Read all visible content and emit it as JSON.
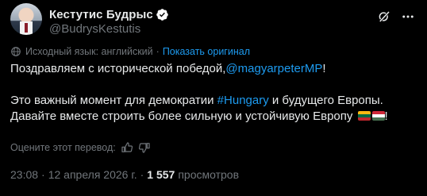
{
  "author": {
    "name": "Кестутис Будрыс",
    "handle": "@BudrysKestutis",
    "verified": true
  },
  "translation": {
    "source_label": "Исходный язык: английский",
    "separator": "·",
    "show_original_label": "Показать оригинал"
  },
  "tweet": {
    "line1_prefix": "Поздравляем с исторической победой,",
    "mention": "@magyarpeterMP",
    "line1_suffix": "!",
    "line2_prefix": "Это важный момент для демократии ",
    "hashtag": "#Hungary",
    "line2_suffix": " и будущего Европы.",
    "line3_text": "Давайте вместе строить более сильную и устойчивую Европу ",
    "line3_suffix": "!",
    "flags": [
      "lithuania-flag",
      "hungary-flag"
    ]
  },
  "rating": {
    "prompt": "Оцените этот перевод:"
  },
  "meta": {
    "time": "23:08",
    "date": "12 апреля 2026 г.",
    "separator": "·",
    "views_count": "1 557",
    "views_label": "просмотров"
  },
  "colors": {
    "background": "#000000",
    "text": "#e7e9ea",
    "secondary": "#71767b",
    "accent": "#1d9bf0"
  }
}
